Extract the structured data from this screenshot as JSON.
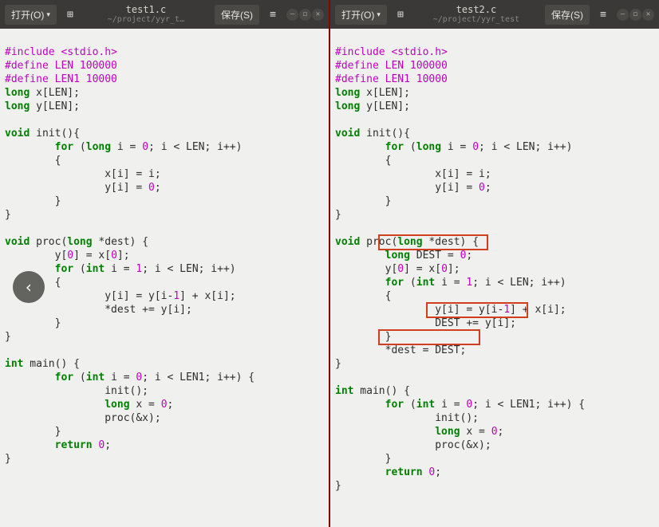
{
  "colors": {
    "keyword": "#008000",
    "preproc": "#c000c0",
    "number": "#c000c0",
    "highlight_border": "#d04020",
    "divider": "#8b0000"
  },
  "left": {
    "toolbar": {
      "open_label": "打开(O)",
      "save_label": "保存(S)",
      "filename": "test1.c",
      "filepath": "~/project/yyr_t…"
    },
    "code": {
      "l1_pp": "#include ",
      "l1_hdr": "<stdio.h>",
      "l2_pp": "#define LEN 100000",
      "l3_pp": "#define LEN1 10000",
      "l4_kw": "long",
      "l4_rest": " x[LEN];",
      "l5_kw": "long",
      "l5_rest": " y[LEN];",
      "l7_kw": "void",
      "l7_rest": " init(){",
      "l8_indent": "        ",
      "l8_kw": "for",
      "l8_a": " (",
      "l8_kw2": "long",
      "l8_b": " i = ",
      "l8_n": "0",
      "l8_c": "; i < LEN; i++)",
      "l9": "        {",
      "l10": "                x[i] = i;",
      "l11_a": "                y[i] = ",
      "l11_n": "0",
      "l11_b": ";",
      "l12": "        }",
      "l13": "}",
      "l15_kw": "void",
      "l15_a": " proc(",
      "l15_kw2": "long",
      "l15_b": " *dest) {",
      "l16_a": "        y[",
      "l16_n0": "0",
      "l16_b": "] = x[",
      "l16_n1": "0",
      "l16_c": "];",
      "l17_indent": "        ",
      "l17_kw": "for",
      "l17_a": " (",
      "l17_kw2": "int",
      "l17_b": " i = ",
      "l17_n": "1",
      "l17_c": "; i < LEN; i++)",
      "l18": "        {",
      "l19_a": "                y[i] = y[i-",
      "l19_n": "1",
      "l19_b": "] + x[i];",
      "l20": "                *dest += y[i];",
      "l21": "        }",
      "l22": "}",
      "l24_kw": "int",
      "l24_rest": " main() {",
      "l25_indent": "        ",
      "l25_kw": "for",
      "l25_a": " (",
      "l25_kw2": "int",
      "l25_b": " i = ",
      "l25_n": "0",
      "l25_c": "; i < LEN1; i++) {",
      "l26": "                init();",
      "l27_indent": "                ",
      "l27_kw": "long",
      "l27_a": " x = ",
      "l27_n": "0",
      "l27_b": ";",
      "l28": "                proc(&x);",
      "l29": "        }",
      "l30_indent": "        ",
      "l30_kw": "return",
      "l30_a": " ",
      "l30_n": "0",
      "l30_b": ";",
      "l31": "}"
    }
  },
  "right": {
    "toolbar": {
      "open_label": "打开(O)",
      "save_label": "保存(S)",
      "filename": "test2.c",
      "filepath": "~/project/yyr_test"
    },
    "code": {
      "l1_pp": "#include ",
      "l1_hdr": "<stdio.h>",
      "l2_pp": "#define LEN 100000",
      "l3_pp": "#define LEN1 10000",
      "l4_kw": "long",
      "l4_rest": " x[LEN];",
      "l5_kw": "long",
      "l5_rest": " y[LEN];",
      "l7_kw": "void",
      "l7_rest": " init(){",
      "l8_indent": "        ",
      "l8_kw": "for",
      "l8_a": " (",
      "l8_kw2": "long",
      "l8_b": " i = ",
      "l8_n": "0",
      "l8_c": "; i < LEN; i++)",
      "l9": "        {",
      "l10": "                x[i] = i;",
      "l11_a": "                y[i] = ",
      "l11_n": "0",
      "l11_b": ";",
      "l12": "        }",
      "l13": "}",
      "l15_kw": "void",
      "l15_a": " proc(",
      "l15_kw2": "long",
      "l15_b": " *dest) {",
      "l16_indent": "        ",
      "l16_kw": "long",
      "l16_a": " DEST = ",
      "l16_n": "0",
      "l16_b": ";",
      "l17_a": "        y[",
      "l17_n0": "0",
      "l17_b": "] = x[",
      "l17_n1": "0",
      "l17_c": "];",
      "l18_indent": "        ",
      "l18_kw": "for",
      "l18_a": " (",
      "l18_kw2": "int",
      "l18_b": " i = ",
      "l18_n": "1",
      "l18_c": "; i < LEN; i++)",
      "l19": "        {",
      "l20_a": "                y[i] = y[i-",
      "l20_n": "1",
      "l20_b": "] + x[i];",
      "l21": "                DEST += y[i];",
      "l22": "        }",
      "l23": "        *dest = DEST;",
      "l24": "}",
      "l26_kw": "int",
      "l26_rest": " main() {",
      "l27_indent": "        ",
      "l27_kw": "for",
      "l27_a": " (",
      "l27_kw2": "int",
      "l27_b": " i = ",
      "l27_n": "0",
      "l27_c": "; i < LEN1; i++) {",
      "l28": "                init();",
      "l29_indent": "                ",
      "l29_kw": "long",
      "l29_a": " x = ",
      "l29_n": "0",
      "l29_b": ";",
      "l30": "                proc(&x);",
      "l31": "        }",
      "l32_indent": "        ",
      "l32_kw": "return",
      "l32_a": " ",
      "l32_n": "0",
      "l32_b": ";",
      "l33": "}"
    }
  },
  "icons": {
    "open_dropdown": "▾",
    "new_doc": "⊞",
    "menu": "≡",
    "minimize": "–",
    "maximize": "◻",
    "close": "✕",
    "back": "‹"
  }
}
